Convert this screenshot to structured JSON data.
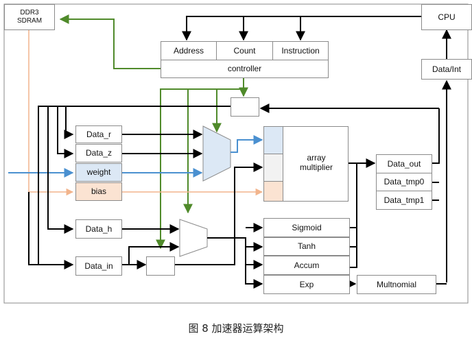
{
  "blocks": {
    "ddr3": "DDR3\nSDRAM",
    "cpu": "CPU",
    "data_int": "Data/Int",
    "address": "Address",
    "count": "Count",
    "instruction": "Instruction",
    "controller": "controller",
    "data_r": "Data_r",
    "data_z": "Data_z",
    "weight": "weight",
    "bias": "bias",
    "data_h": "Data_h",
    "data_in": "Data_in",
    "array_multiplier": "array\nmultiplier",
    "data_out": "Data_out",
    "data_tmp0": "Data_tmp0",
    "data_tmp1": "Data_tmp1",
    "sigmoid": "Sigmoid",
    "tanh": "Tanh",
    "accum": "Accum",
    "exp": "Exp",
    "multnomial": "Multnomial"
  },
  "caption": "图 8   加速器运算架构",
  "colors": {
    "line": "#000000",
    "green": "#4f8a2a",
    "blue": "#4a90d0",
    "orange": "#f2b48c",
    "weight_fill": "#dce8f5",
    "bias_fill": "#fbe3d2",
    "mux_fill": "#dce8f5",
    "border": "#8a8a8a"
  }
}
